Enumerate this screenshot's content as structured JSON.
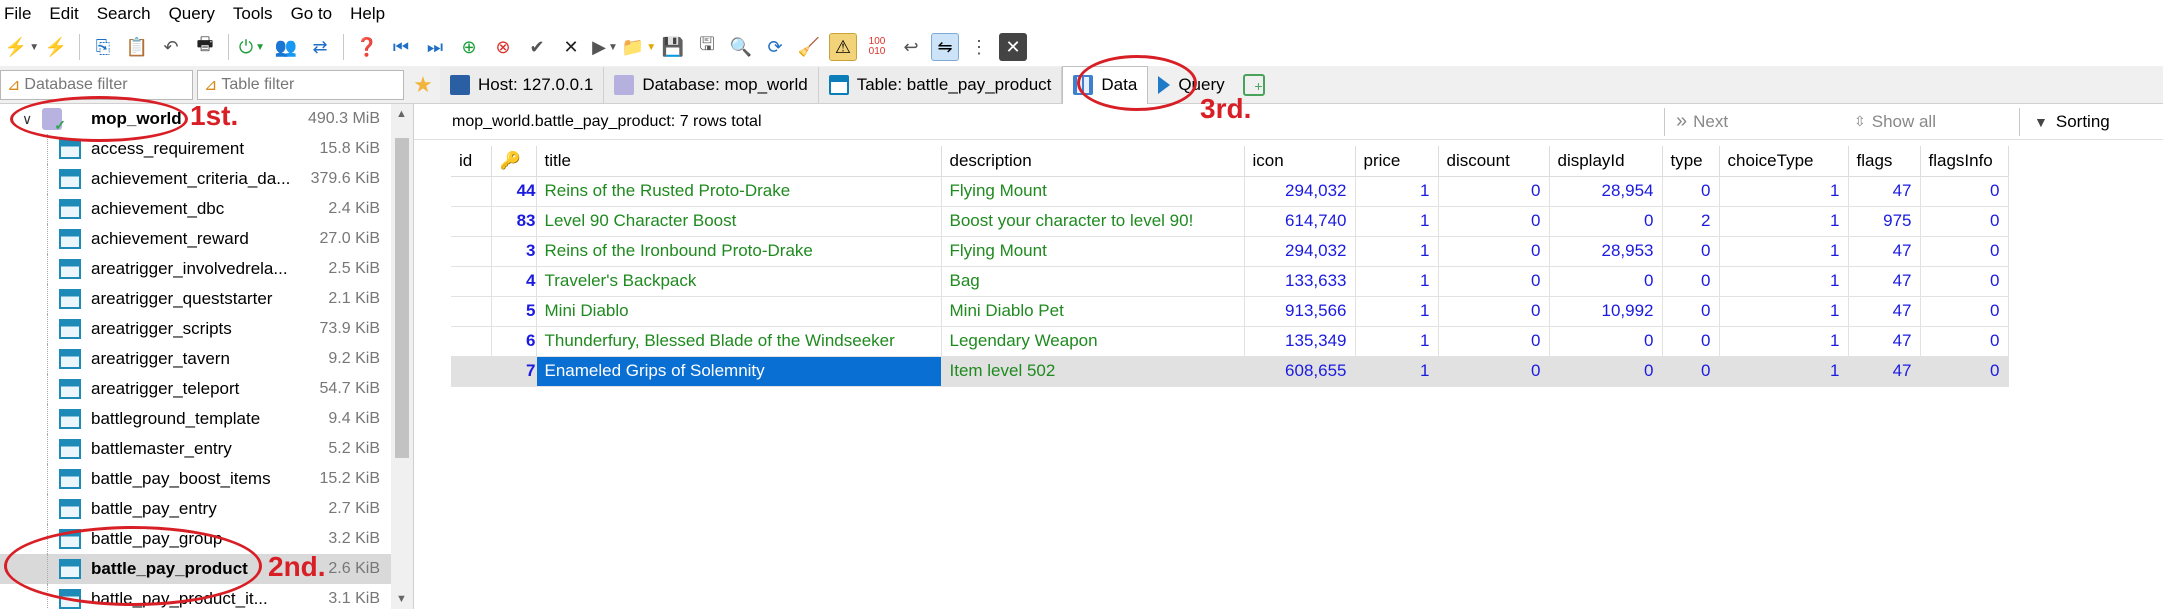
{
  "menu": [
    "File",
    "Edit",
    "Search",
    "Query",
    "Tools",
    "Go to",
    "Help"
  ],
  "filters": {
    "database_placeholder": "Database filter",
    "table_placeholder": "Table filter"
  },
  "tabs": [
    {
      "label": "Host: 127.0.0.1",
      "icon": "host-icon"
    },
    {
      "label": "Database: mop_world",
      "icon": "database-icon"
    },
    {
      "label": "Table: battle_pay_product",
      "icon": "table-icon"
    },
    {
      "label": "Data",
      "icon": "data-grid-icon",
      "active": true
    },
    {
      "label": "Query",
      "icon": "query-icon"
    }
  ],
  "tree": {
    "root": {
      "name": "mop_world",
      "size": "490.3 MiB"
    },
    "items": [
      {
        "name": "access_requirement",
        "size": "15.8 KiB"
      },
      {
        "name": "achievement_criteria_da...",
        "size": "379.6 KiB"
      },
      {
        "name": "achievement_dbc",
        "size": "2.4 KiB"
      },
      {
        "name": "achievement_reward",
        "size": "27.0 KiB"
      },
      {
        "name": "areatrigger_involvedrela...",
        "size": "2.5 KiB"
      },
      {
        "name": "areatrigger_queststarter",
        "size": "2.1 KiB"
      },
      {
        "name": "areatrigger_scripts",
        "size": "73.9 KiB"
      },
      {
        "name": "areatrigger_tavern",
        "size": "9.2 KiB"
      },
      {
        "name": "areatrigger_teleport",
        "size": "54.7 KiB"
      },
      {
        "name": "battleground_template",
        "size": "9.4 KiB"
      },
      {
        "name": "battlemaster_entry",
        "size": "5.2 KiB"
      },
      {
        "name": "battle_pay_boost_items",
        "size": "15.2 KiB"
      },
      {
        "name": "battle_pay_entry",
        "size": "2.7 KiB"
      },
      {
        "name": "battle_pay_group",
        "size": "3.2 KiB"
      },
      {
        "name": "battle_pay_product",
        "size": "2.6 KiB",
        "selected": true
      },
      {
        "name": "battle_pay_product_it...",
        "size": "3.1 KiB"
      }
    ]
  },
  "infobar": {
    "summary": "mop_world.battle_pay_product: 7 rows total",
    "next": "Next",
    "show_all": "Show all",
    "sorting": "Sorting"
  },
  "grid": {
    "columns": [
      "id",
      "",
      "title",
      "description",
      "icon",
      "price",
      "discount",
      "displayId",
      "type",
      "choiceType",
      "flags",
      "flagsInfo"
    ],
    "rows": [
      {
        "id": "44",
        "title": "Reins of the Rusted Proto-Drake",
        "description": "Flying Mount",
        "icon": "294,032",
        "price": "1",
        "discount": "0",
        "displayId": "28,954",
        "type": "0",
        "choiceType": "1",
        "flags": "47",
        "flagsInfo": "0"
      },
      {
        "id": "83",
        "title": "Level 90 Character Boost",
        "description": "Boost your character to level 90!",
        "icon": "614,740",
        "price": "1",
        "discount": "0",
        "displayId": "0",
        "type": "2",
        "choiceType": "1",
        "flags": "975",
        "flagsInfo": "0"
      },
      {
        "id": "3",
        "title": "Reins of the Ironbound Proto-Drake",
        "description": "Flying Mount",
        "icon": "294,032",
        "price": "1",
        "discount": "0",
        "displayId": "28,953",
        "type": "0",
        "choiceType": "1",
        "flags": "47",
        "flagsInfo": "0"
      },
      {
        "id": "4",
        "title": "Traveler's Backpack",
        "description": "Bag",
        "icon": "133,633",
        "price": "1",
        "discount": "0",
        "displayId": "0",
        "type": "0",
        "choiceType": "1",
        "flags": "47",
        "flagsInfo": "0"
      },
      {
        "id": "5",
        "title": "Mini Diablo",
        "description": "Mini Diablo Pet",
        "icon": "913,566",
        "price": "1",
        "discount": "0",
        "displayId": "10,992",
        "type": "0",
        "choiceType": "1",
        "flags": "47",
        "flagsInfo": "0"
      },
      {
        "id": "6",
        "title": "Thunderfury, Blessed Blade of the Windseeker",
        "description": "Legendary Weapon",
        "icon": "135,349",
        "price": "1",
        "discount": "0",
        "displayId": "0",
        "type": "0",
        "choiceType": "1",
        "flags": "47",
        "flagsInfo": "0"
      },
      {
        "id": "7",
        "title": "Enameled Grips of Solemnity",
        "description": "Item level 502",
        "icon": "608,655",
        "price": "1",
        "discount": "0",
        "displayId": "0",
        "type": "0",
        "choiceType": "1",
        "flags": "47",
        "flagsInfo": "0",
        "selected": true
      }
    ]
  },
  "annotations": {
    "first": "1st.",
    "second": "2nd.",
    "third": "3rd."
  },
  "colors": {
    "annotation": "#d81f26",
    "selection": "#0a6fd2",
    "number_text": "#1b1be0",
    "string_text": "#1f8a1f"
  }
}
